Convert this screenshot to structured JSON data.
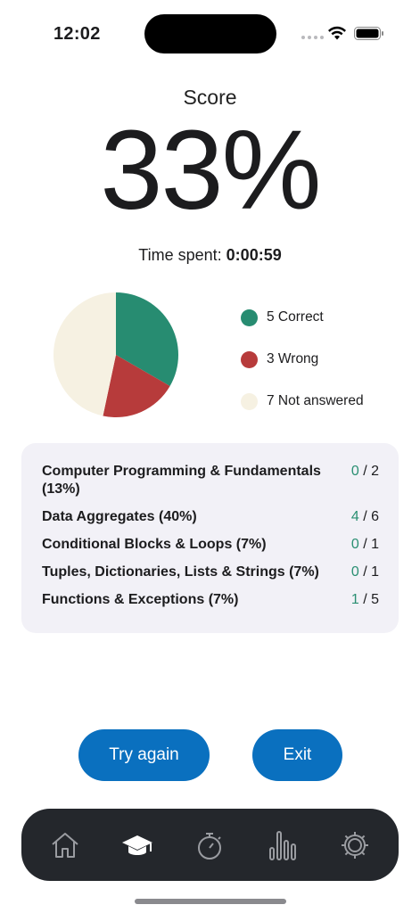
{
  "status_bar": {
    "time": "12:02"
  },
  "score": {
    "label": "Score",
    "value": "33%"
  },
  "time_spent": {
    "label": "Time spent:",
    "value": "0:00:59"
  },
  "chart_data": {
    "type": "pie",
    "slices": [
      {
        "label": "Correct",
        "value": 5,
        "color": "#278c71"
      },
      {
        "label": "Wrong",
        "value": 3,
        "color": "#b73b3b"
      },
      {
        "label": "Not answered",
        "value": 7,
        "color": "#f6f1e2"
      }
    ]
  },
  "legend": [
    {
      "text": "5 Correct",
      "color": "#278c71"
    },
    {
      "text": "3 Wrong",
      "color": "#b73b3b"
    },
    {
      "text": "7 Not answered",
      "color": "#f6f1e2"
    }
  ],
  "topics": [
    {
      "name": "Computer Programming & Fundamentals (13%)",
      "correct": "0",
      "separator": " / ",
      "total": "2"
    },
    {
      "name": "Data Aggregates (40%)",
      "correct": "4",
      "separator": " / ",
      "total": "6"
    },
    {
      "name": "Conditional Blocks & Loops (7%)",
      "correct": "0",
      "separator": " / ",
      "total": "1"
    },
    {
      "name": "Tuples, Dictionaries, Lists & Strings (7%)",
      "correct": "0",
      "separator": " / ",
      "total": "1"
    },
    {
      "name": "Functions & Exceptions (7%)",
      "correct": "1",
      "separator": " / ",
      "total": "5"
    }
  ],
  "buttons": {
    "try_again": "Try again",
    "exit": "Exit"
  },
  "tab_bar": {
    "tabs": [
      {
        "icon": "home-icon",
        "active": false
      },
      {
        "icon": "graduation-cap-icon",
        "active": true
      },
      {
        "icon": "stopwatch-icon",
        "active": false
      },
      {
        "icon": "bar-chart-icon",
        "active": false
      },
      {
        "icon": "settings-gear-icon",
        "active": false
      }
    ]
  },
  "colors": {
    "accent": "#0a70bf",
    "correct": "#2a8f72",
    "tab_bar": "#24272c"
  }
}
